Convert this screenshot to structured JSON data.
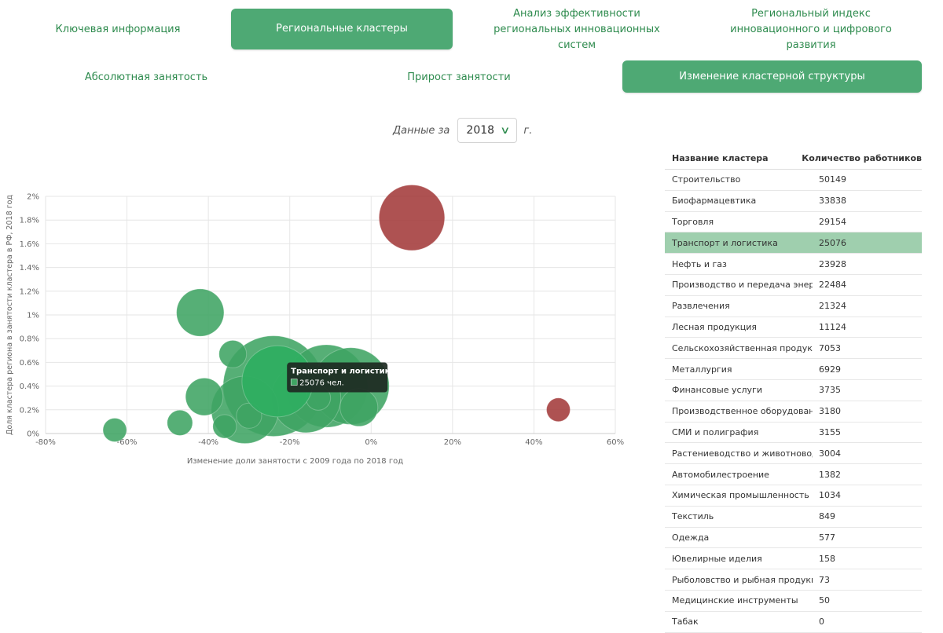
{
  "tabs_row1": [
    {
      "label": "Ключевая информация",
      "active": false
    },
    {
      "label": "Региональные кластеры",
      "active": true
    },
    {
      "label": "Анализ эффективности региональных инновационных систем",
      "active": false
    },
    {
      "label": "Региональный индекс инновационного и цифрового развития",
      "active": false
    }
  ],
  "tabs_row2": [
    {
      "label": "Абсолютная занятость",
      "active": false
    },
    {
      "label": "Прирост занятости",
      "active": false
    },
    {
      "label": "Изменение кластерной структуры",
      "active": true
    }
  ],
  "year_filter": {
    "prefix": "Данные за",
    "value": "2018",
    "suffix": "г."
  },
  "colors": {
    "accent": "#4ea974",
    "bubble_green": "#3fa463",
    "bubble_red": "#a33a3a",
    "highlight_row": "#9fcfae"
  },
  "chart_data": {
    "type": "bubble",
    "xlabel": "Изменение доли занятости с 2009 года по 2018 год",
    "ylabel": "Доля кластера региона в занятости кластера в РФ, 2018 год",
    "xlim": [
      -80,
      60
    ],
    "ylim": [
      0,
      2
    ],
    "x_ticks": [
      "-80%",
      "-60%",
      "-40%",
      "-20%",
      "0%",
      "20%",
      "40%",
      "60%"
    ],
    "y_ticks": [
      "0%",
      "0.2%",
      "0.4%",
      "0.6%",
      "0.8%",
      "1%",
      "1.2%",
      "1.4%",
      "1.6%",
      "1.8%",
      "2%"
    ],
    "grid": true,
    "points": [
      {
        "x": -24,
        "y": 0.4,
        "size": 50149,
        "color": "green"
      },
      {
        "x": -11,
        "y": 0.4,
        "size": 33838,
        "color": "green"
      },
      {
        "x": -5,
        "y": 0.4,
        "size": 29154,
        "color": "green"
      },
      {
        "x": -23,
        "y": 0.44,
        "size": 25076,
        "color": "green",
        "highlighted": true
      },
      {
        "x": -16,
        "y": 0.3,
        "size": 23928,
        "color": "green"
      },
      {
        "x": -31,
        "y": 0.2,
        "size": 22484,
        "color": "green"
      },
      {
        "x": 10,
        "y": 1.82,
        "size": 21324,
        "color": "red"
      },
      {
        "x": -42,
        "y": 1.02,
        "size": 11124,
        "color": "green"
      },
      {
        "x": -3,
        "y": 0.22,
        "size": 7053,
        "color": "green"
      },
      {
        "x": -41,
        "y": 0.31,
        "size": 6929,
        "color": "green"
      },
      {
        "x": -34,
        "y": 0.67,
        "size": 3735,
        "color": "green"
      },
      {
        "x": -47,
        "y": 0.09,
        "size": 3180,
        "color": "green"
      },
      {
        "x": -30,
        "y": 0.15,
        "size": 3155,
        "color": "green"
      },
      {
        "x": -13,
        "y": 0.3,
        "size": 3004,
        "color": "green"
      },
      {
        "x": -63,
        "y": 0.03,
        "size": 1382,
        "color": "green"
      },
      {
        "x": -36,
        "y": 0.06,
        "size": 1034,
        "color": "green"
      },
      {
        "x": 46,
        "y": 0.2,
        "size": 849,
        "color": "red"
      }
    ],
    "tooltip": {
      "title": "Транспорт и логистика",
      "value": "25076 чел."
    }
  },
  "table": {
    "headers": [
      "Название кластера",
      "Количество работников"
    ],
    "highlight_index": 3,
    "rows": [
      [
        "Строительство",
        "50149"
      ],
      [
        "Биофармацевтика",
        "33838"
      ],
      [
        "Торговля",
        "29154"
      ],
      [
        "Транспорт и логистика",
        "25076"
      ],
      [
        "Нефть и газ",
        "23928"
      ],
      [
        "Производство и передача энергии",
        "22484"
      ],
      [
        "Развлечения",
        "21324"
      ],
      [
        "Лесная продукция",
        "11124"
      ],
      [
        "Сельскохозяйственная продукция",
        "7053"
      ],
      [
        "Металлургия",
        "6929"
      ],
      [
        "Финансовые услуги",
        "3735"
      ],
      [
        "Производственное оборудование",
        "3180"
      ],
      [
        "СМИ и полиграфия",
        "3155"
      ],
      [
        "Растениеводство и животноводство",
        "3004"
      ],
      [
        "Автомобилестроение",
        "1382"
      ],
      [
        "Химическая промышленность",
        "1034"
      ],
      [
        "Текстиль",
        "849"
      ],
      [
        "Одежда",
        "577"
      ],
      [
        "Ювелирные иделия",
        "158"
      ],
      [
        "Рыболовство и рыбная продукция",
        "73"
      ],
      [
        "Медицинские инструменты",
        "50"
      ],
      [
        "Табак",
        "0"
      ]
    ]
  }
}
